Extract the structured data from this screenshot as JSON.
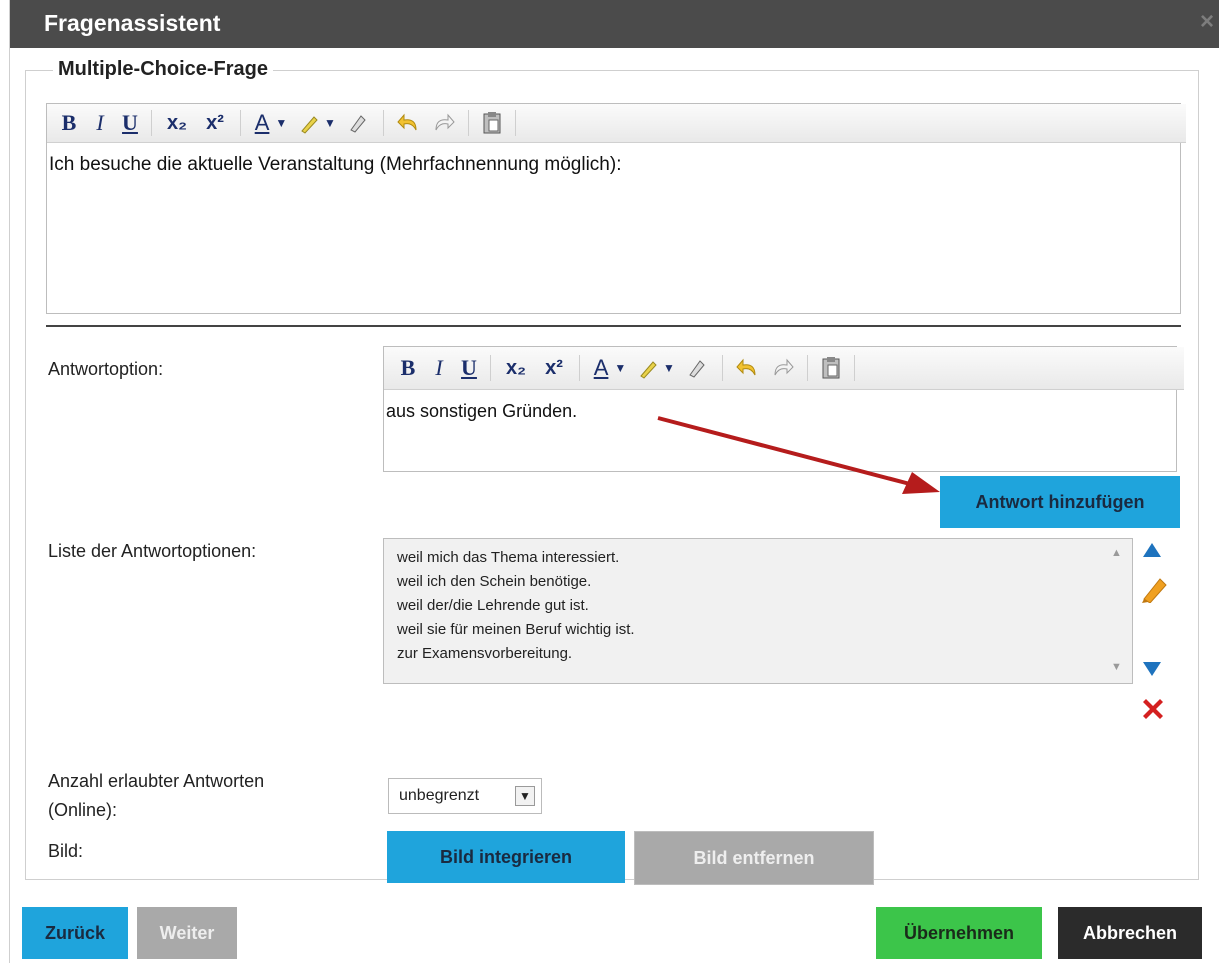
{
  "dialog": {
    "title": "Fragenassistent",
    "close_glyph": "×"
  },
  "section": {
    "legend": "Multiple-Choice-Frage"
  },
  "toolbar": {
    "bold": "B",
    "italic": "I",
    "underline": "U",
    "subscript": "x₂",
    "superscript": "x²",
    "font_color": "A",
    "icons": [
      "bold-icon",
      "italic-icon",
      "underline-icon",
      "subscript-icon",
      "superscript-icon",
      "font-color-icon",
      "highlight-icon",
      "eraser-icon",
      "undo-icon",
      "redo-icon",
      "paste-icon"
    ]
  },
  "question": {
    "text": "Ich besuche die aktuelle Veranstaltung (Mehrfachnennung möglich):"
  },
  "answer_option": {
    "label": "Antwortoption:",
    "text": "aus sonstigen Gründen.",
    "add_button": "Antwort hinzufügen"
  },
  "options_list": {
    "label": "Liste der Antwortoptionen:",
    "items": [
      "weil mich das Thema interessiert.",
      "weil ich den Schein benötige.",
      "weil der/die Lehrende gut ist.",
      "weil sie für meinen Beruf wichtig ist.",
      "zur Examensvorbereitung."
    ]
  },
  "allowed_answers": {
    "label_line1": "Anzahl erlaubter Antworten",
    "label_line2": "(Online):",
    "selected": "unbegrenzt"
  },
  "image": {
    "label": "Bild:",
    "integrate_button": "Bild integrieren",
    "remove_button": "Bild entfernen"
  },
  "footer": {
    "back": "Zurück",
    "next": "Weiter",
    "apply": "Übernehmen",
    "cancel": "Abbrechen"
  },
  "colors": {
    "titlebar": "#4b4b4b",
    "blue_button": "#1fa4dc",
    "green_button": "#3cc54a",
    "dark_button": "#2b2b2b",
    "grey_button": "#a9a9a9",
    "arrow": "#b51c1c",
    "delete_x": "#d42020",
    "move_triangle": "#1e73be",
    "pencil": "#f0a020"
  }
}
